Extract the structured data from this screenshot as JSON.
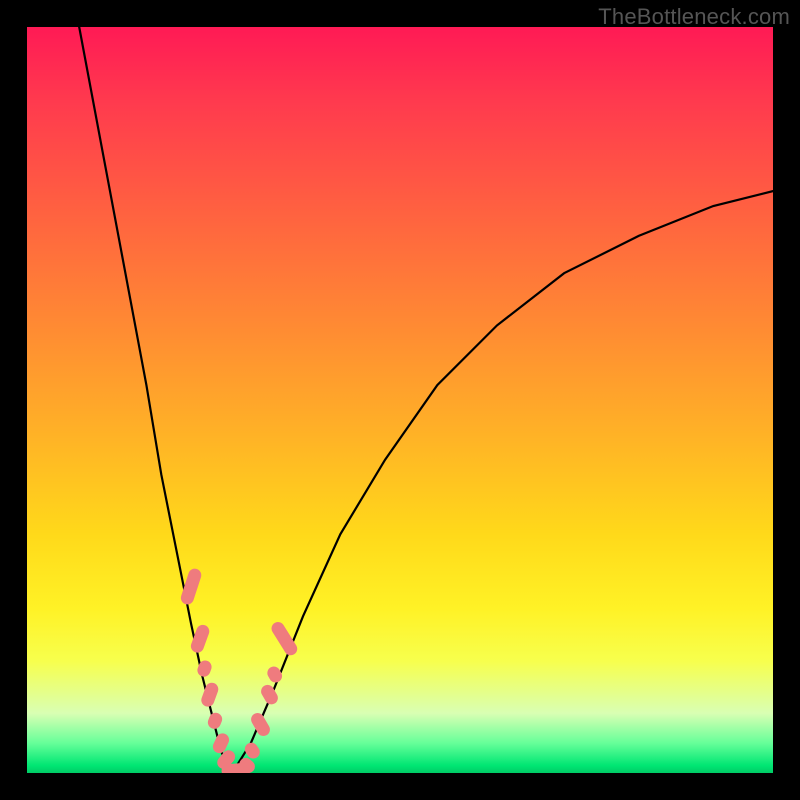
{
  "watermark": "TheBottleneck.com",
  "chart_data": {
    "type": "line",
    "title": "",
    "xlabel": "",
    "ylabel": "",
    "xlim": [
      0,
      100
    ],
    "ylim": [
      0,
      100
    ],
    "background_gradient_note": "vertical rainbow gradient red→green indicating mismatch (red high) to match (green low)",
    "series": [
      {
        "name": "left-curve",
        "x": [
          7,
          10,
          13,
          16,
          18,
          20,
          22,
          23.5,
          25,
          26,
          26.8,
          27.5
        ],
        "y": [
          100,
          84,
          68,
          52,
          40,
          30,
          20,
          13,
          7,
          3,
          1,
          0
        ]
      },
      {
        "name": "right-curve",
        "x": [
          27.5,
          30,
          33,
          37,
          42,
          48,
          55,
          63,
          72,
          82,
          92,
          100
        ],
        "y": [
          0,
          4,
          11,
          21,
          32,
          42,
          52,
          60,
          67,
          72,
          76,
          78
        ]
      }
    ],
    "markers": {
      "name": "cluster-pink",
      "color": "#ef7b7e",
      "approx_note": "pill-shaped pink markers clustered near valley on both curves",
      "points": [
        {
          "x": 22.0,
          "y": 25,
          "len": 9,
          "angle": -72
        },
        {
          "x": 23.2,
          "y": 18,
          "len": 7,
          "angle": -70
        },
        {
          "x": 23.8,
          "y": 14,
          "len": 4,
          "angle": -70
        },
        {
          "x": 24.5,
          "y": 10.5,
          "len": 6,
          "angle": -70
        },
        {
          "x": 25.2,
          "y": 7,
          "len": 4,
          "angle": -68
        },
        {
          "x": 26.0,
          "y": 4,
          "len": 5,
          "angle": -65
        },
        {
          "x": 26.7,
          "y": 1.8,
          "len": 5,
          "angle": -50
        },
        {
          "x": 28.0,
          "y": 0.4,
          "len": 7,
          "angle": -5
        },
        {
          "x": 29.5,
          "y": 1.0,
          "len": 4,
          "angle": 40
        },
        {
          "x": 30.2,
          "y": 3.0,
          "len": 4,
          "angle": 55
        },
        {
          "x": 31.3,
          "y": 6.5,
          "len": 6,
          "angle": 60
        },
        {
          "x": 32.5,
          "y": 10.5,
          "len": 5,
          "angle": 60
        },
        {
          "x": 33.2,
          "y": 13.2,
          "len": 4,
          "angle": 60
        },
        {
          "x": 34.5,
          "y": 18.0,
          "len": 9,
          "angle": 58
        }
      ]
    }
  }
}
